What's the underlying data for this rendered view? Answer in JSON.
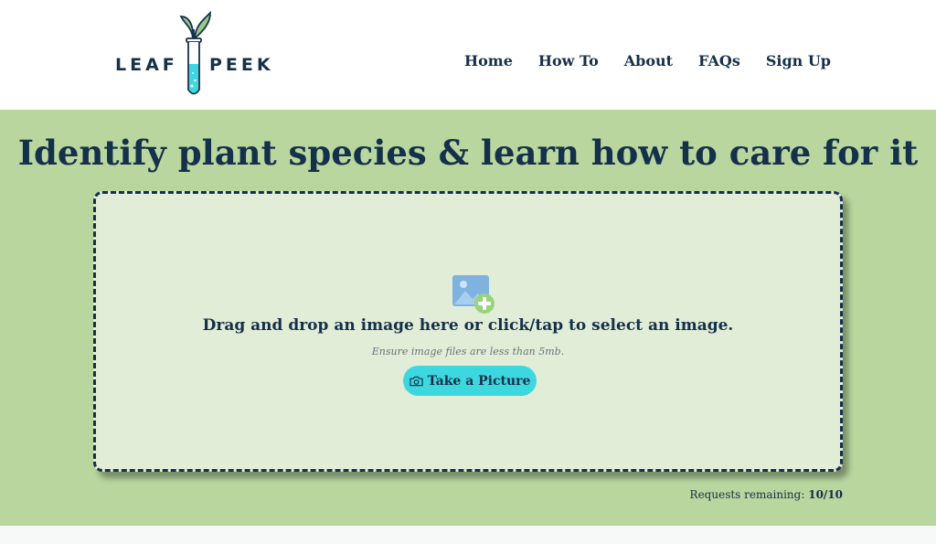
{
  "logo": {
    "left_text": "LEAF",
    "right_text": "PEEK"
  },
  "nav": {
    "items": [
      "Home",
      "How To",
      "About",
      "FAQs",
      "Sign Up"
    ]
  },
  "hero": {
    "headline": "Identify plant species & learn how to care for it"
  },
  "dropzone": {
    "icon": "add-image-icon",
    "instruction": "Drag and drop an image here or click/tap to select an image.",
    "note": "Ensure image files are less than 5mb.",
    "button_label": "Take a Picture",
    "button_icon": "camera-icon"
  },
  "requests": {
    "label": "Requests remaining:",
    "value": "10/10"
  },
  "colors": {
    "accent": "#3dd7e0",
    "hero_bg": "#b8d69e",
    "dropzone_bg": "#e1edd6",
    "text": "#15304a"
  }
}
